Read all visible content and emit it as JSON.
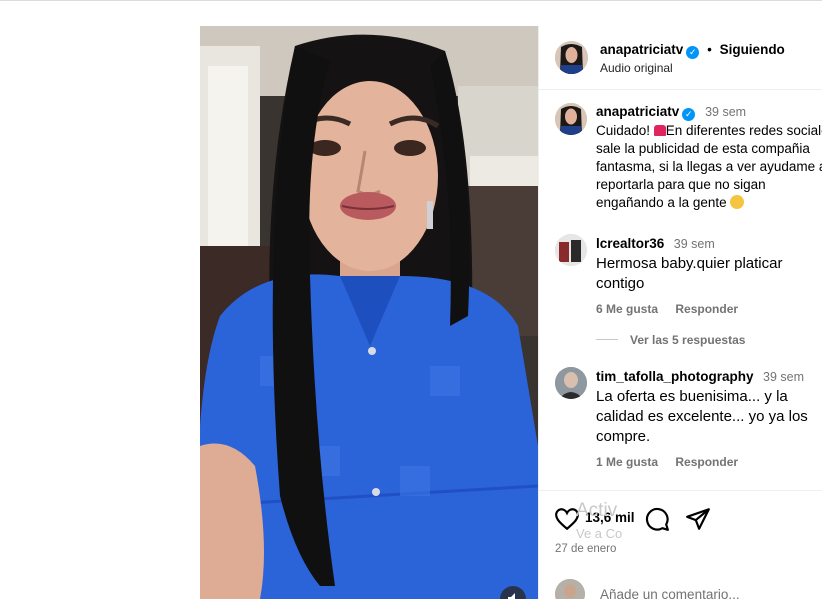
{
  "post": {
    "author": "anapatriciatv",
    "follow_status": "Siguiendo",
    "separator": "•",
    "audio": "Audio original"
  },
  "caption": {
    "username": "anapatriciatv",
    "time": "39 sem",
    "text_1": "Cuidado! ",
    "text_2": "En diferentes redes sociales sale la publicidad de esta compañia fantasma, si la llegas a ver ayudame a reportarla para que no sigan engañando a la gente "
  },
  "comments": [
    {
      "username": "lcrealtor36",
      "time": "39 sem",
      "text": "Hermosa baby.quier platicar contigo",
      "likes": "6 Me gusta",
      "reply": "Responder",
      "view_replies": "Ver las 5 respuestas"
    },
    {
      "username": "tim_tafolla_photography",
      "time": "39 sem",
      "text": "La oferta es buenisima... y la calidad es excelente... yo ya los compre.",
      "likes": "1 Me gusta",
      "reply": "Responder"
    }
  ],
  "actions": {
    "likes_count": "13,6 mil",
    "date": "27 de enero"
  },
  "add_comment": {
    "placeholder": "Añade un comentario..."
  },
  "overlay": {
    "watermark_1": "Activ",
    "watermark_2": "Ve a Co"
  },
  "icons": {
    "verified": "verified-badge-icon",
    "like": "heart-icon",
    "comment": "comment-bubble-icon",
    "share": "paper-plane-icon",
    "mute": "speaker-icon"
  },
  "colors": {
    "verified_blue": "#0095f6",
    "muted_text": "#737373",
    "dress_blue": "#2b63d9"
  }
}
